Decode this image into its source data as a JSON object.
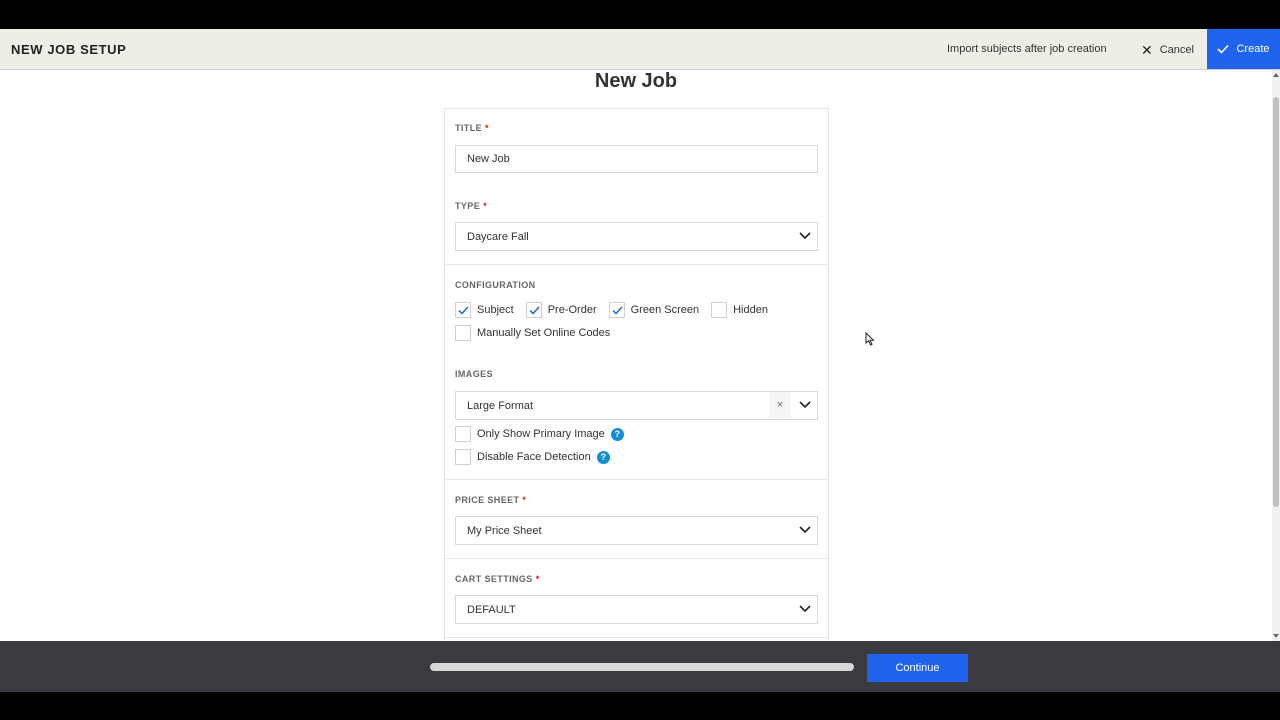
{
  "header": {
    "title": "NEW JOB SETUP",
    "import_text": "Import subjects after job creation",
    "cancel_label": "Cancel",
    "create_label": "Create"
  },
  "page_title": "New Job",
  "form": {
    "title": {
      "label": "TITLE",
      "required": "*",
      "value": "New Job"
    },
    "type": {
      "label": "TYPE",
      "required": "*",
      "value": "Daycare Fall"
    },
    "configuration": {
      "label": "CONFIGURATION",
      "options": [
        {
          "label": "Subject",
          "checked": true
        },
        {
          "label": "Pre-Order",
          "checked": true
        },
        {
          "label": "Green Screen",
          "checked": true
        },
        {
          "label": "Hidden",
          "checked": false
        },
        {
          "label": "Manually Set Online Codes",
          "checked": false
        }
      ]
    },
    "images": {
      "label": "IMAGES",
      "value": "Large Format",
      "clear": "×",
      "options": [
        {
          "label": "Only Show Primary Image",
          "checked": false,
          "help": "?"
        },
        {
          "label": "Disable Face Detection",
          "checked": false,
          "help": "?"
        }
      ]
    },
    "price_sheet": {
      "label": "PRICE SHEET",
      "required": "*",
      "value": "My Price Sheet"
    },
    "cart_settings": {
      "label": "CART SETTINGS",
      "required": "*",
      "value": "DEFAULT"
    }
  },
  "footer": {
    "continue_label": "Continue"
  },
  "colors": {
    "accent": "#1f63ee",
    "help_icon": "#0f8fd6",
    "required": "#d21919"
  }
}
